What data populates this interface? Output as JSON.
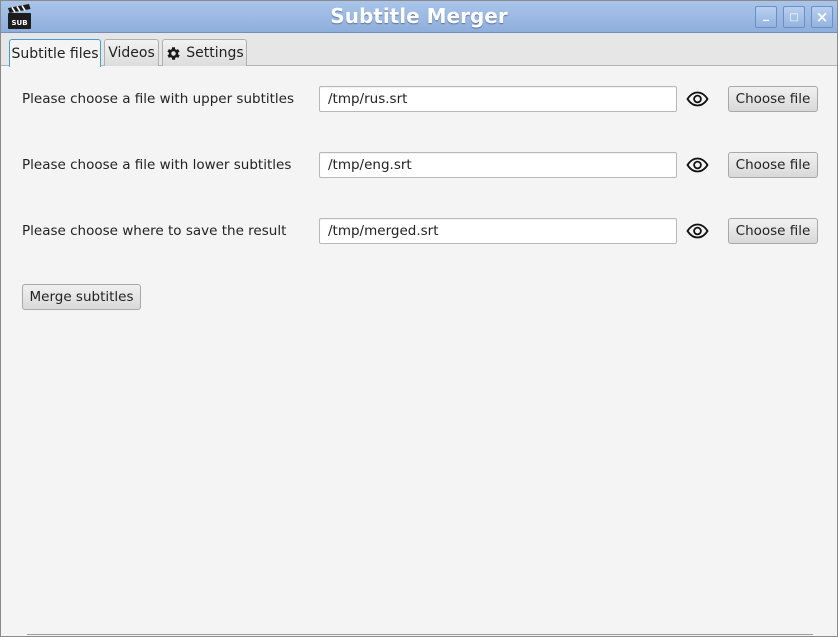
{
  "window": {
    "title": "Subtitle Merger",
    "app_icon": "clapperboard-sub-icon",
    "app_icon_text": "SUB",
    "controls": {
      "minimize": "_",
      "maximize": "□",
      "close": "×"
    }
  },
  "tabs": [
    {
      "label": "Subtitle files",
      "active": true
    },
    {
      "label": "Videos",
      "active": false
    },
    {
      "label": "Settings",
      "active": false,
      "icon": "gear-icon"
    }
  ],
  "rows": [
    {
      "label": "Please choose a file with upper subtitles",
      "value": "/tmp/rus.srt",
      "button": "Choose file"
    },
    {
      "label": "Please choose a file with lower subtitles",
      "value": "/tmp/eng.srt",
      "button": "Choose file"
    },
    {
      "label": "Please choose where to save the result",
      "value": "/tmp/merged.srt",
      "button": "Choose file"
    }
  ],
  "actions": {
    "merge": "Merge subtitles"
  },
  "colors": {
    "titlebar": "#9bb9e6",
    "active_tab_border": "#3d9fd8",
    "background": "#f4f4f4"
  }
}
